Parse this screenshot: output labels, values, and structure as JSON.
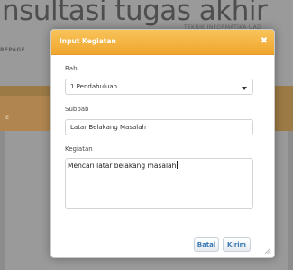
{
  "background": {
    "site_title": "nsultasi tugas akhir",
    "site_subtitle": "TEKNIK INFORMATIKA UAD",
    "nav_home": "REPAGE",
    "tab_label": "E"
  },
  "dialog": {
    "title": "Input Kegiatan",
    "close_icon": "close-icon",
    "close_glyph": "✖",
    "bab": {
      "label": "Bab",
      "selected": "1 Pendahuluan"
    },
    "subbab": {
      "label": "Subbab",
      "value": "Latar Belakang Masalah"
    },
    "kegiatan": {
      "label": "Kegiatan",
      "value": "Mencari latar belakang masalah"
    },
    "buttons": {
      "cancel": "Batal",
      "submit": "Kirim"
    }
  },
  "colors": {
    "header": "#f0a62d",
    "button_text": "#3a79b5",
    "overlay_orange": "#9c7a45"
  }
}
